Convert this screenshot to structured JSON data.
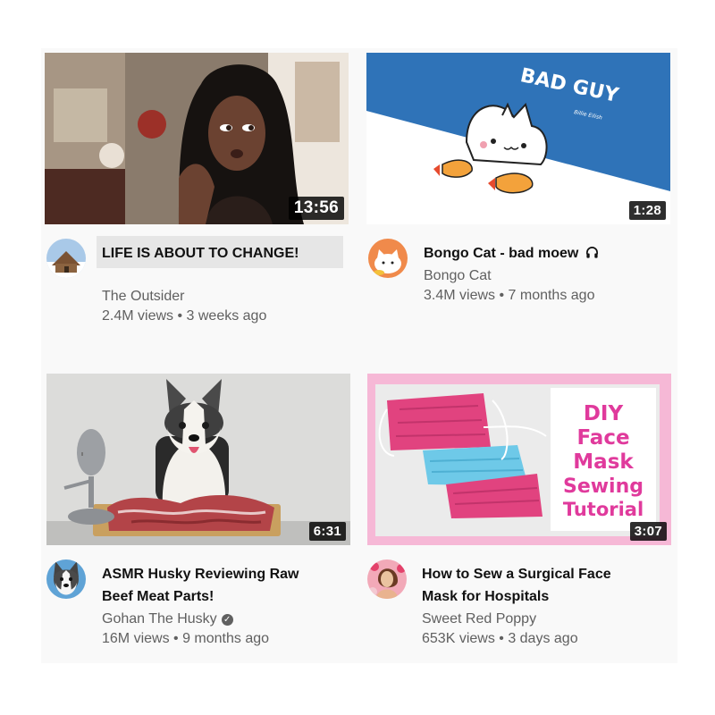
{
  "videos": [
    {
      "title": "LIFE IS ABOUT TO CHANGE!",
      "title_line2": "",
      "channel": "The Outsider",
      "stats": "2.4M views • 3 weeks ago",
      "duration": "13:56"
    },
    {
      "title": "Bongo Cat - bad moew",
      "title_line2": "",
      "channel": "Bongo Cat",
      "stats": "3.4M views • 7 months ago",
      "duration": "1:28",
      "thumb_text": "BAD GUY",
      "thumb_subtext": "Billie Eilish",
      "title_icon": "headphones-icon"
    },
    {
      "title": "ASMR Husky Reviewing Raw",
      "title_line2": "Beef Meat Parts!",
      "channel": "Gohan The Husky",
      "verified_icon": "verified-icon",
      "verified_glyph": "✓",
      "stats": "16M views • 9 months ago",
      "duration": "6:31"
    },
    {
      "title": "How to Sew a Surgical Face",
      "title_line2": "Mask for Hospitals",
      "channel": "Sweet Red Poppy",
      "stats": "653K views • 3 days ago",
      "duration": "3:07",
      "thumb_lines": [
        "DIY",
        "Face",
        "Mask",
        "Sewing",
        "Tutorial"
      ]
    }
  ],
  "colors": {
    "panel_bg": "#f9f9f9",
    "title_highlight": "#e6e6e6",
    "text_primary": "#111111",
    "text_secondary": "#606060",
    "bongo_bg": "#2f73b8",
    "diy_pink": "#e03a9c"
  }
}
